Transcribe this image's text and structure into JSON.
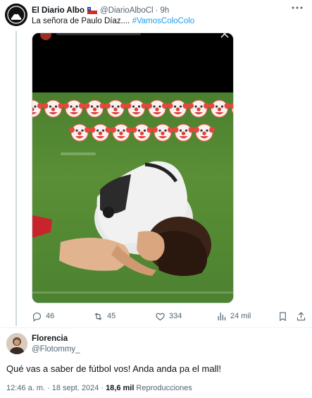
{
  "quoted_post": {
    "author_name": "El Diario Albo",
    "author_flag": "chile-flag-icon",
    "author_handle": "@DiarioAlboCl",
    "separator": "·",
    "time_ago": "9h",
    "text": "La señora de Paulo Díaz.... ",
    "hashtag": "#VamosColoColo",
    "actions": {
      "replies": "46",
      "retweets": "45",
      "likes": "334",
      "views": "24 mil"
    }
  },
  "reply": {
    "author_name": "Florencia",
    "author_handle": "@Flotommy_",
    "text": "Qué vas a saber de fútbol vos! Anda anda pa el mall!"
  },
  "meta": {
    "time": "12:46 a. m.",
    "sep1": "·",
    "date": "18 sept. 2024",
    "sep2": "·",
    "views_count": "18,6 mil",
    "views_label": "Reproducciones"
  },
  "icons": {
    "reply": "reply-icon",
    "retweet": "retweet-icon",
    "like": "heart-icon",
    "views": "views-chart-icon",
    "bookmark": "bookmark-icon",
    "share": "share-icon",
    "more": "more-dots-icon",
    "media_emoji": "clown-face-emoji"
  },
  "colors": {
    "link": "#1d9bf0",
    "muted": "#536471",
    "text": "#0f1419",
    "pitch": "#4f8532"
  }
}
